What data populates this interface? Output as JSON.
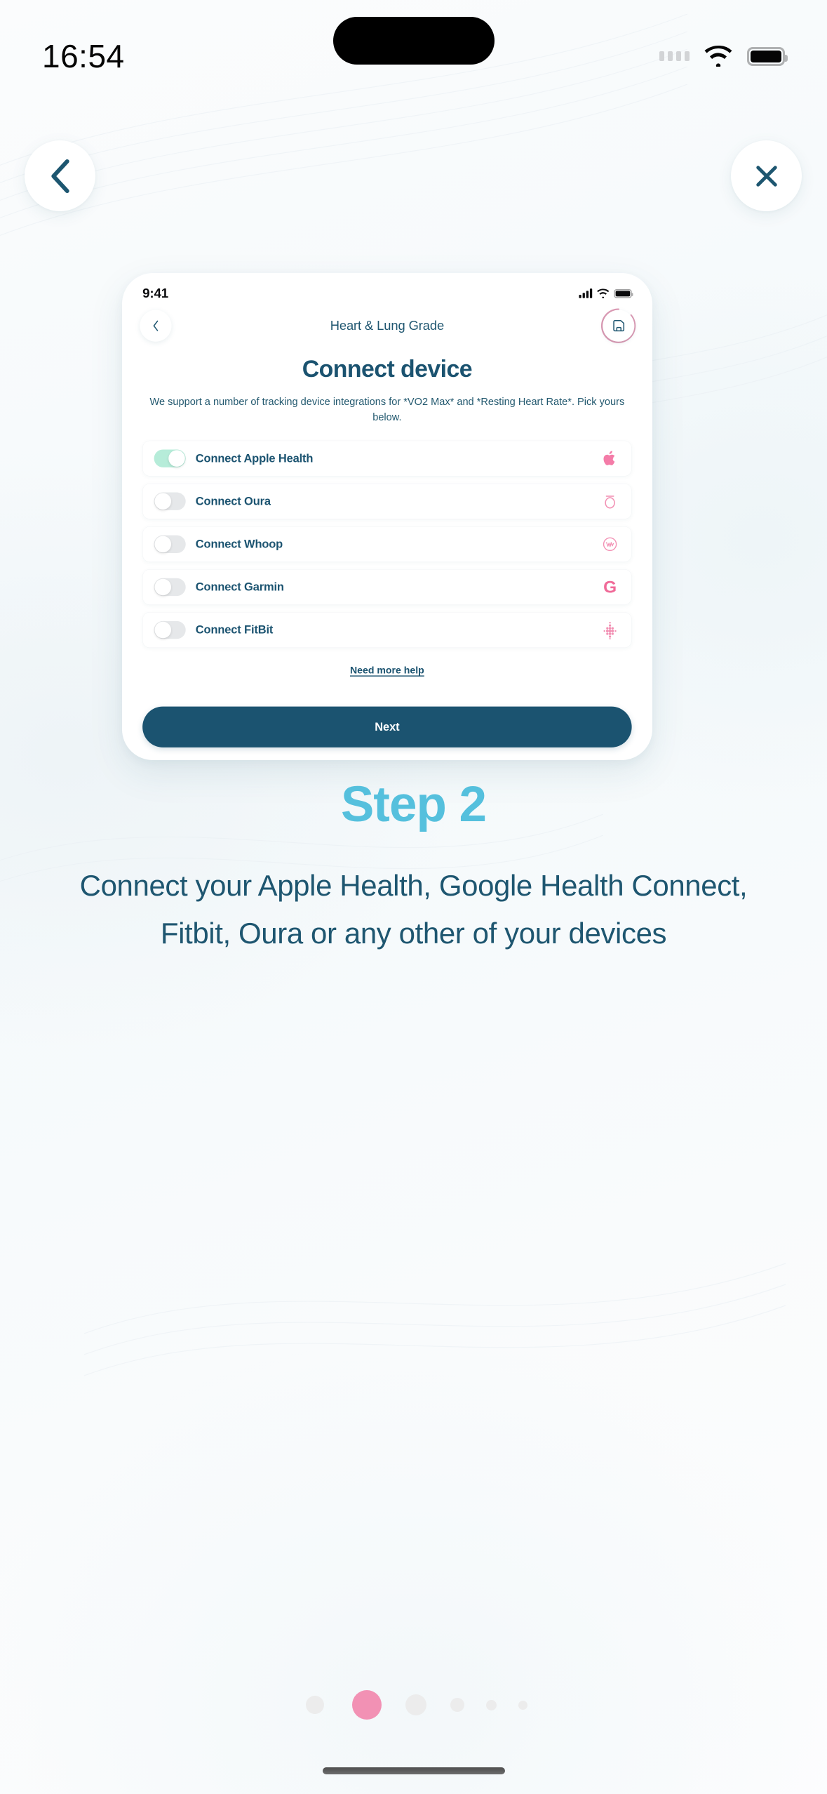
{
  "system_status_bar": {
    "time": "16:54",
    "icons": [
      "cellular-dots-icon",
      "wifi-icon",
      "battery-icon"
    ]
  },
  "nav": {
    "back_icon": "chevron-left-icon",
    "close_icon": "close-icon"
  },
  "phone_mockup": {
    "status_bar": {
      "time": "9:41",
      "icons": [
        "signal-bars-icon",
        "wifi-icon",
        "battery-icon"
      ]
    },
    "header": {
      "back_icon": "chevron-left-icon",
      "title": "Heart & Lung Grade",
      "save_icon": "save-floppy-icon"
    },
    "heading": "Connect device",
    "subtitle": "We support a number of tracking device integrations for *VO2 Max* and *Resting Heart Rate*. Pick yours below.",
    "devices": [
      {
        "label": "Connect Apple Health",
        "enabled": true,
        "icon": "apple-logo-icon"
      },
      {
        "label": "Connect Oura",
        "enabled": false,
        "icon": "oura-ring-icon"
      },
      {
        "label": "Connect Whoop",
        "enabled": false,
        "icon": "whoop-logo-icon"
      },
      {
        "label": "Connect Garmin",
        "enabled": false,
        "icon": "garmin-logo-icon"
      },
      {
        "label": "Connect FitBit",
        "enabled": false,
        "icon": "fitbit-logo-icon"
      }
    ],
    "help_link": "Need more help",
    "primary_button": "Next"
  },
  "step": {
    "title": "Step 2",
    "description": "Connect your Apple Health, Google Health Connect, Fitbit, Oura or any other of your devices"
  },
  "pagination": {
    "dots": [
      {
        "active": false,
        "size": 26
      },
      {
        "active": true,
        "size": 42
      },
      {
        "active": false,
        "size": 30
      },
      {
        "active": false,
        "size": 20
      },
      {
        "active": false,
        "size": 15
      },
      {
        "active": false,
        "size": 13
      }
    ]
  },
  "colors": {
    "accent_teal": "#1b5370",
    "accent_pink": "#f291b4",
    "step_blue": "#55c0dd",
    "toggle_on": "#b6ecd9",
    "toggle_off": "#e6e8ea",
    "background": "#f7fafb"
  }
}
